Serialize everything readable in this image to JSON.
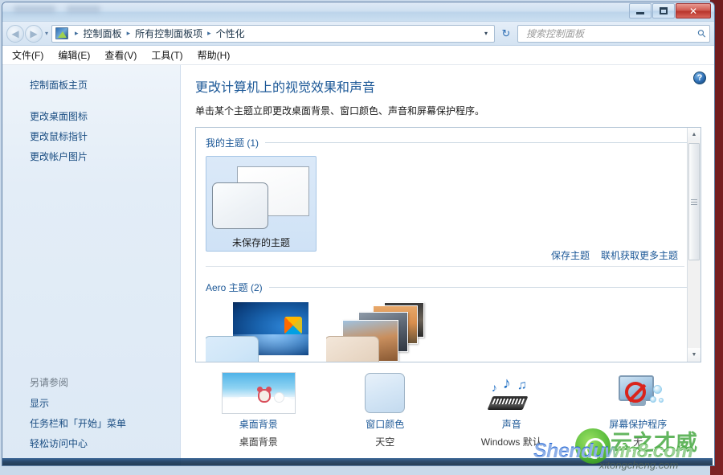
{
  "window": {
    "controls": {
      "minimize": "–",
      "maximize": "□",
      "close": "✕"
    }
  },
  "nav": {
    "back_icon": "◀",
    "forward_icon": "▶",
    "history_chevron": "▾",
    "path_icon": "personalization-icon",
    "breadcrumbs": [
      "控制面板",
      "所有控制面板项",
      "个性化"
    ],
    "separator": "▸",
    "address_dropdown": "▾",
    "refresh_icon": "↻",
    "refresh_label": "刷新"
  },
  "search": {
    "placeholder": "搜索控制面板",
    "value": "",
    "icon": "search-icon"
  },
  "menubar": {
    "items": [
      "文件(F)",
      "编辑(E)",
      "查看(V)",
      "工具(T)",
      "帮助(H)"
    ]
  },
  "sidebar": {
    "home": "控制面板主页",
    "links": [
      "更改桌面图标",
      "更改鼠标指针",
      "更改帐户图片"
    ],
    "see_also_heading": "另请参阅",
    "see_also": [
      "显示",
      "任务栏和「开始」菜单",
      "轻松访问中心"
    ]
  },
  "content": {
    "help_icon": "?",
    "title": "更改计算机上的视觉效果和声音",
    "subtitle": "单击某个主题立即更改桌面背景、窗口颜色、声音和屏幕保护程序。",
    "groups": [
      {
        "heading": "我的主题 (1)",
        "themes": [
          {
            "label": "未保存的主题",
            "selected": true,
            "thumb": "unsaved-theme-thumb"
          }
        ]
      },
      {
        "heading": "Aero 主题 (2)",
        "themes": [
          {
            "label": "",
            "selected": false,
            "thumb": "aero-windows7-thumb"
          },
          {
            "label": "",
            "selected": false,
            "thumb": "aero-photostack-thumb"
          }
        ]
      }
    ],
    "panel_links": [
      "保存主题",
      "联机获取更多主题"
    ],
    "scrollbar": {
      "up": "▲",
      "down": "▼"
    }
  },
  "options": [
    {
      "name": "desktop-background",
      "title": "桌面背景",
      "value": "桌面背景",
      "icon": "wallpaper-thumb"
    },
    {
      "name": "window-color",
      "title": "窗口颜色",
      "value": "天空",
      "icon": "color-swatch-icon"
    },
    {
      "name": "sounds",
      "title": "声音",
      "value": "Windows 默认",
      "icon": "sound-notes-icon"
    },
    {
      "name": "screen-saver",
      "title": "屏幕保护程序",
      "value": "无",
      "icon": "screensaver-icon"
    }
  ],
  "watermark": {
    "main": "Shenduwin8.com",
    "sub": "xitongcheng.com",
    "cn": "云之才威"
  },
  "colors": {
    "link": "#1c5897",
    "title": "#1c5897",
    "selection": "#cfe2f6",
    "window_border": "#5d7da3",
    "close_button": "#b8352c",
    "desktop": "#6f1c1f"
  }
}
